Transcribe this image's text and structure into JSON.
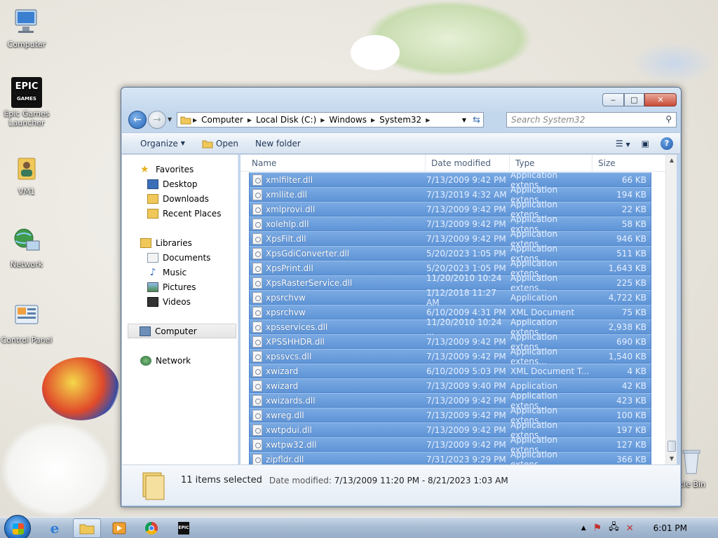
{
  "desktop": {
    "icons": [
      {
        "label": "Computer"
      },
      {
        "label": "Epic Games Launcher"
      },
      {
        "label": "VM1"
      },
      {
        "label": "Network"
      },
      {
        "label": "Control Panel"
      },
      {
        "label": "cle Bin"
      }
    ],
    "epic_logo_text": "EPIC",
    "epic_logo_sub": "GAMES"
  },
  "window": {
    "address": {
      "crumbs": [
        "Computer",
        "Local Disk (C:)",
        "Windows",
        "System32"
      ]
    },
    "search_placeholder": "Search System32",
    "toolbar": {
      "organize": "Organize",
      "open": "Open",
      "new_folder": "New folder"
    },
    "navpane": {
      "favorites": "Favorites",
      "desktop": "Desktop",
      "downloads": "Downloads",
      "recent_places": "Recent Places",
      "libraries": "Libraries",
      "documents": "Documents",
      "music": "Music",
      "pictures": "Pictures",
      "videos": "Videos",
      "computer": "Computer",
      "network": "Network"
    },
    "columns": {
      "name": "Name",
      "date": "Date modified",
      "type": "Type",
      "size": "Size"
    },
    "files": [
      {
        "name": "xmlfilter.dll",
        "date": "7/13/2009 9:42 PM",
        "type": "Application extens...",
        "size": "66 KB"
      },
      {
        "name": "xmllite.dll",
        "date": "7/13/2019 4:32 AM",
        "type": "Application extens...",
        "size": "194 KB"
      },
      {
        "name": "xmlprovi.dll",
        "date": "7/13/2009 9:42 PM",
        "type": "Application extens...",
        "size": "22 KB"
      },
      {
        "name": "xolehlp.dll",
        "date": "7/13/2009 9:42 PM",
        "type": "Application extens...",
        "size": "58 KB"
      },
      {
        "name": "XpsFilt.dll",
        "date": "7/13/2009 9:42 PM",
        "type": "Application extens...",
        "size": "946 KB"
      },
      {
        "name": "XpsGdiConverter.dll",
        "date": "5/20/2023 1:05 PM",
        "type": "Application extens...",
        "size": "511 KB"
      },
      {
        "name": "XpsPrint.dll",
        "date": "5/20/2023 1:05 PM",
        "type": "Application extens...",
        "size": "1,643 KB"
      },
      {
        "name": "XpsRasterService.dll",
        "date": "11/20/2010 10:24 ...",
        "type": "Application extens...",
        "size": "225 KB"
      },
      {
        "name": "xpsrchvw",
        "date": "1/12/2018 11:27 AM",
        "type": "Application",
        "size": "4,722 KB"
      },
      {
        "name": "xpsrchvw",
        "date": "6/10/2009 4:31 PM",
        "type": "XML Document",
        "size": "75 KB"
      },
      {
        "name": "xpsservices.dll",
        "date": "11/20/2010 10:24 ...",
        "type": "Application extens...",
        "size": "2,938 KB"
      },
      {
        "name": "XPSSHHDR.dll",
        "date": "7/13/2009 9:42 PM",
        "type": "Application extens...",
        "size": "690 KB"
      },
      {
        "name": "xpssvcs.dll",
        "date": "7/13/2009 9:42 PM",
        "type": "Application extens...",
        "size": "1,540 KB"
      },
      {
        "name": "xwizard",
        "date": "6/10/2009 5:03 PM",
        "type": "XML Document T...",
        "size": "4 KB"
      },
      {
        "name": "xwizard",
        "date": "7/13/2009 9:40 PM",
        "type": "Application",
        "size": "42 KB"
      },
      {
        "name": "xwizards.dll",
        "date": "7/13/2009 9:42 PM",
        "type": "Application extens...",
        "size": "423 KB"
      },
      {
        "name": "xwreg.dll",
        "date": "7/13/2009 9:42 PM",
        "type": "Application extens...",
        "size": "100 KB"
      },
      {
        "name": "xwtpdui.dll",
        "date": "7/13/2009 9:42 PM",
        "type": "Application extens...",
        "size": "197 KB"
      },
      {
        "name": "xwtpw32.dll",
        "date": "7/13/2009 9:42 PM",
        "type": "Application extens...",
        "size": "127 KB"
      },
      {
        "name": "zipfldr.dll",
        "date": "7/31/2023 9:29 PM",
        "type": "Application extens...",
        "size": "366 KB"
      }
    ],
    "details": {
      "count": "11 items selected",
      "date_label": "Date modified:",
      "date_range": "7/13/2009 11:20 PM - 8/21/2023 1:03 AM"
    }
  },
  "taskbar": {
    "clock": "6:01 PM",
    "epic_label": "EPIC"
  },
  "colors": {
    "selection": "#6a9ddc",
    "accent": "#2765b8"
  }
}
